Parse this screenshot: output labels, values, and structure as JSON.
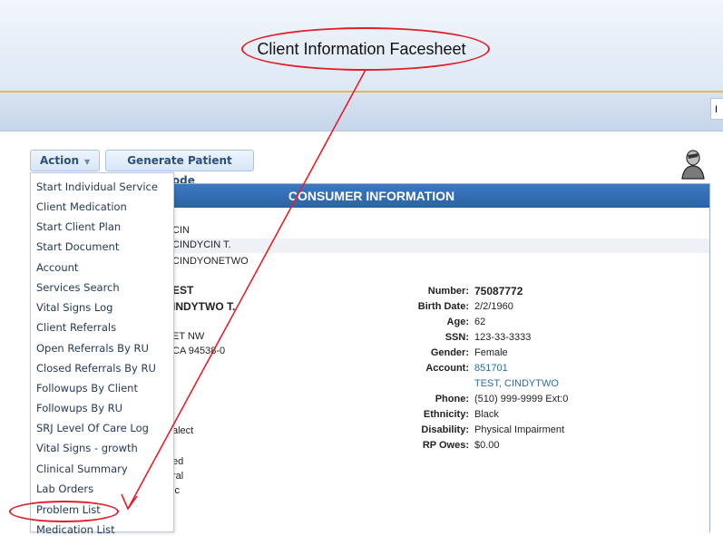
{
  "header": {
    "title": "Client Information Facesheet"
  },
  "toolbar": {
    "action_label": "Action",
    "generate_label": "Generate Patient Code"
  },
  "panel": {
    "title": "CONSUMER INFORMATION",
    "top_rows": [
      "CIN",
      "CINDYCIN T.",
      "CINDYONETWO"
    ],
    "left": {
      "surname": "EST",
      "name": "INDYTWO T.",
      "address1": "ET NW",
      "address2": "CA 94538-0",
      "frag1": "alect",
      "frag2": "ed",
      "frag3": "ral",
      "frag4": "ic"
    },
    "info": [
      {
        "label": "Number:",
        "value": "75087772"
      },
      {
        "label": "Birth Date:",
        "value": "2/2/1960"
      },
      {
        "label": "Age:",
        "value": "62"
      },
      {
        "label": "SSN:",
        "value": "123-33-3333"
      },
      {
        "label": "Gender:",
        "value": "Female"
      },
      {
        "label": "Account:",
        "value": "851701"
      },
      {
        "label": "",
        "value": "TEST, CINDYTWO"
      },
      {
        "label": "Phone:",
        "value": "(510) 999-9999 Ext:0"
      },
      {
        "label": "Ethnicity:",
        "value": "Black"
      },
      {
        "label": "Disability:",
        "value": "Physical Impairment"
      },
      {
        "label": "RP Owes:",
        "value": "$0.00"
      }
    ]
  },
  "menu": {
    "items": [
      "Start Individual Service",
      "Client Medication",
      "Start Client Plan",
      "Start Document",
      "Account",
      "Services Search",
      "Vital Signs Log",
      "Client Referrals",
      "Open Referrals By RU",
      "Closed Referrals By RU",
      "Followups By Client",
      "Followups By RU",
      "SRJ Level Of Care Log",
      "Vital Signs - growth",
      "Clinical Summary",
      "Lab Orders",
      "Problem List",
      "Medication List"
    ]
  },
  "colors": {
    "annotation": "#e0202a",
    "header_blue": "#2b63a6"
  }
}
